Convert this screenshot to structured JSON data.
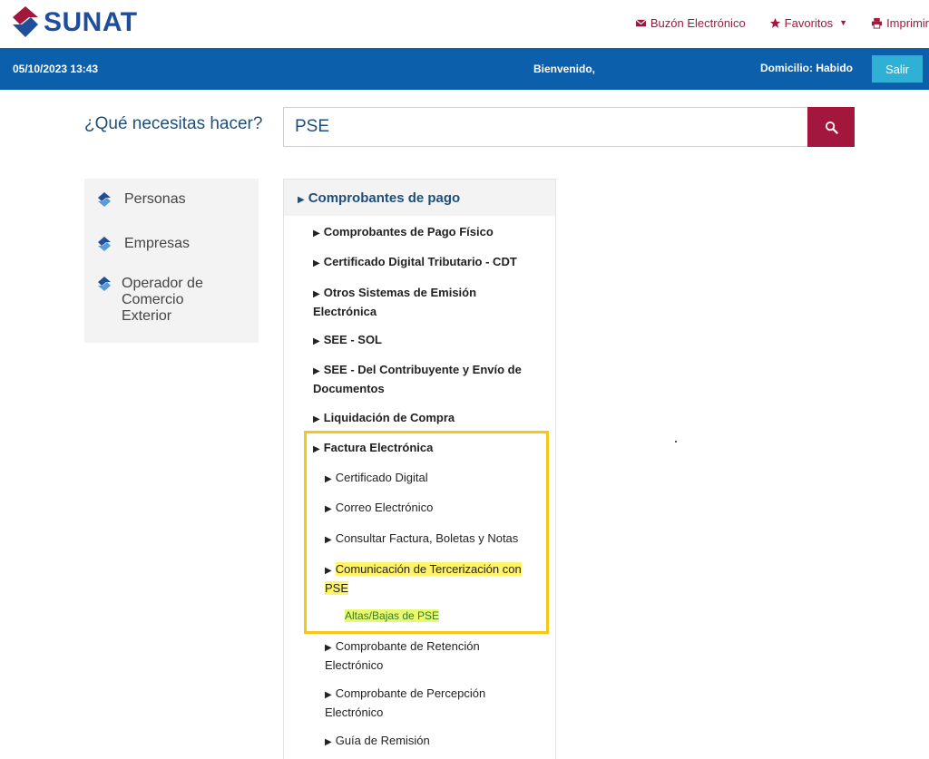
{
  "header": {
    "logo_text": "SUNAT",
    "links": [
      {
        "label": "Buzón Electrónico",
        "icon": "envelope-icon"
      },
      {
        "label": "Favoritos",
        "icon": "star-icon"
      },
      {
        "label": "Imprimir",
        "icon": "printer-icon"
      }
    ]
  },
  "bar": {
    "datetime": "05/10/2023 13:43",
    "welcome": "Bienvenido,",
    "domicilio": "Domicilio: Habido",
    "salir_label": "Salir"
  },
  "question": "¿Qué necesitas hacer?",
  "search": {
    "value": "PSE"
  },
  "sidebar": {
    "items": [
      {
        "label": "Personas"
      },
      {
        "label": "Empresas"
      },
      {
        "label": "Operador de Comercio Exterior"
      }
    ]
  },
  "menu": {
    "header": "Comprobantes de pago",
    "items": [
      {
        "label": "Comprobantes de Pago Físico"
      },
      {
        "label": "Certificado Digital Tributario - CDT"
      },
      {
        "label": "Otros Sistemas de Emisión Electrónica"
      },
      {
        "label": "SEE - SOL"
      },
      {
        "label": "SEE - Del Contribuyente y Envío de Documentos"
      },
      {
        "label": "Liquidación de Compra"
      },
      {
        "label": "Factura Electrónica"
      }
    ],
    "sub_items": [
      {
        "label": "Certificado Digital"
      },
      {
        "label": "Correo Electrónico"
      },
      {
        "label": "Consultar Factura, Boletas y Notas"
      },
      {
        "label": "Comunicación de Tercerización con PSE"
      },
      {
        "label": "Comprobante de Retención Electrónico"
      },
      {
        "label": "Comprobante de Percepción Electrónico"
      },
      {
        "label": "Guía de Remisión"
      }
    ],
    "sub_sub_link": "Altas/Bajas de PSE"
  },
  "colors": {
    "brand_blue": "#0c5fab",
    "brand_red": "#a4173d",
    "highlight_border": "#f5c518",
    "highlight_fill": "#fff36a"
  }
}
